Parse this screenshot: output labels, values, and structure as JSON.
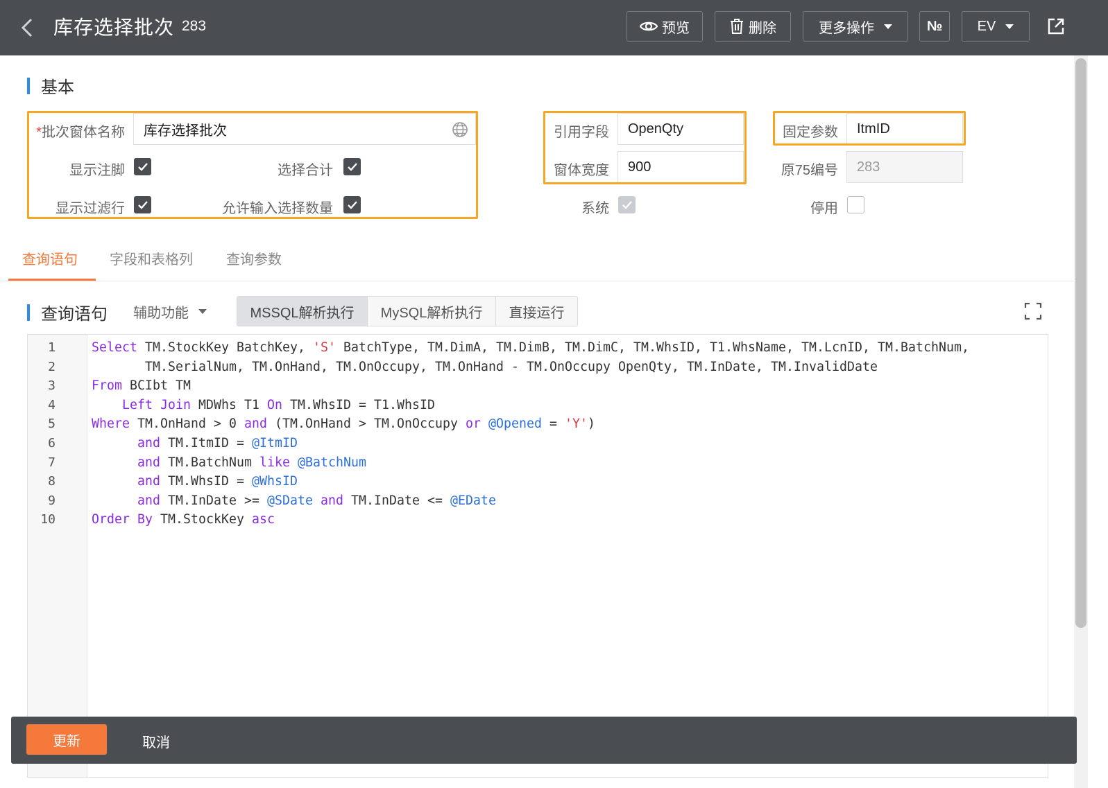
{
  "header": {
    "title": "库存选择批次",
    "record_id": "283",
    "buttons": {
      "preview": "预览",
      "delete": "删除",
      "more": "更多操作",
      "numbering": "№",
      "ev": "EV"
    }
  },
  "basic": {
    "section_title": "基本",
    "batch_window_name_label": "批次窗体名称",
    "batch_window_name_required": "*",
    "batch_window_name_value": "库存选择批次",
    "show_footer_label": "显示注脚",
    "select_total_label": "选择合计",
    "show_filter_row_label": "显示过滤行",
    "allow_input_qty_label": "允许输入选择数量",
    "ref_field_label": "引用字段",
    "ref_field_value": "OpenQty",
    "window_width_label": "窗体宽度",
    "window_width_value": "900",
    "system_label": "系统",
    "fixed_param_label": "固定参数",
    "fixed_param_value": "ItmID",
    "orig75_label": "原75编号",
    "orig75_value": "283",
    "disabled_label": "停用",
    "checks": {
      "show_footer": true,
      "select_total": true,
      "show_filter_row": true,
      "allow_input_qty": true,
      "system": true,
      "disabled": false
    }
  },
  "tabs": [
    "查询语句",
    "字段和表格列",
    "查询参数"
  ],
  "query": {
    "section_title": "查询语句",
    "aux_label": "辅助功能",
    "modes": [
      "MSSQL解析执行",
      "MySQL解析执行",
      "直接运行"
    ],
    "active_mode": "MSSQL解析执行"
  },
  "editor": {
    "line_numbers": [
      "1",
      "2",
      "3",
      "4",
      "5",
      "6",
      "7",
      "8",
      "9",
      "10"
    ],
    "lines": [
      [
        [
          "kw",
          "Select"
        ],
        [
          "t",
          " TM.StockKey BatchKey, "
        ],
        [
          "str",
          "'S'"
        ],
        [
          "t",
          " BatchType, TM.DimA, TM.DimB, TM.DimC, TM.WhsID, T1.WhsName, TM.LcnID, TM.BatchNum,"
        ]
      ],
      [
        [
          "t",
          "       TM.SerialNum, TM.OnHand, TM.OnOccupy, TM.OnHand - TM.OnOccupy OpenQty, TM.InDate, TM.InvalidDate"
        ]
      ],
      [
        [
          "kw",
          "From"
        ],
        [
          "t",
          " BCIbt TM"
        ]
      ],
      [
        [
          "t",
          "    "
        ],
        [
          "kw",
          "Left Join"
        ],
        [
          "t",
          " MDWhs T1 "
        ],
        [
          "kw",
          "On"
        ],
        [
          "t",
          " TM.WhsID = T1.WhsID"
        ]
      ],
      [
        [
          "kw",
          "Where"
        ],
        [
          "t",
          " TM.OnHand > 0 "
        ],
        [
          "kw",
          "and"
        ],
        [
          "t",
          " (TM.OnHand > TM.OnOccupy "
        ],
        [
          "kw",
          "or"
        ],
        [
          "t",
          " "
        ],
        [
          "var",
          "@Opened"
        ],
        [
          "t",
          " = "
        ],
        [
          "str",
          "'Y'"
        ],
        [
          "t",
          ")"
        ]
      ],
      [
        [
          "t",
          "      "
        ],
        [
          "kw",
          "and"
        ],
        [
          "t",
          " TM.ItmID = "
        ],
        [
          "var",
          "@ItmID"
        ]
      ],
      [
        [
          "t",
          "      "
        ],
        [
          "kw",
          "and"
        ],
        [
          "t",
          " TM.BatchNum "
        ],
        [
          "kw",
          "like"
        ],
        [
          "t",
          " "
        ],
        [
          "var",
          "@BatchNum"
        ]
      ],
      [
        [
          "t",
          "      "
        ],
        [
          "kw",
          "and"
        ],
        [
          "t",
          " TM.WhsID = "
        ],
        [
          "var",
          "@WhsID"
        ]
      ],
      [
        [
          "t",
          "      "
        ],
        [
          "kw",
          "and"
        ],
        [
          "t",
          " TM.InDate >= "
        ],
        [
          "var",
          "@SDate"
        ],
        [
          "t",
          " "
        ],
        [
          "kw",
          "and"
        ],
        [
          "t",
          " TM.InDate <= "
        ],
        [
          "var",
          "@EDate"
        ]
      ],
      [
        [
          "kw",
          "Order By"
        ],
        [
          "t",
          " TM.StockKey "
        ],
        [
          "kw",
          "asc"
        ]
      ]
    ]
  },
  "footer": {
    "update": "更新",
    "cancel": "取消"
  },
  "colors": {
    "topbar": "#4a4d52",
    "accent_orange": "#f5793a",
    "highlight": "#f5a623",
    "section_bar": "#2d8cf0",
    "keyword": "#8a2be2",
    "string": "#d63a3a",
    "variable": "#2c6fd6"
  }
}
